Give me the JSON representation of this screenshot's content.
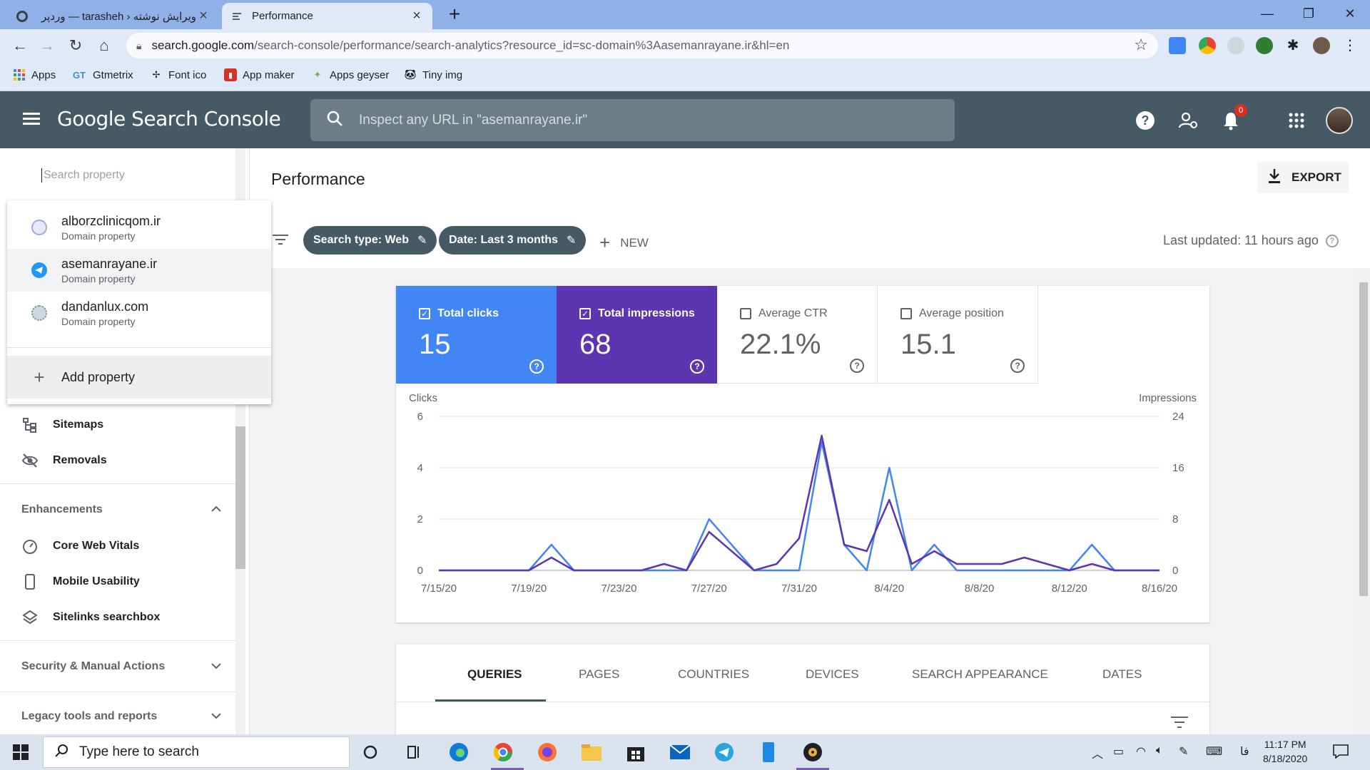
{
  "browser": {
    "tabs": [
      {
        "title": "ویرایش نوشته ‹ tarasheh — وردپر",
        "active": false
      },
      {
        "title": "Performance",
        "active": true
      }
    ],
    "url_host": "search.google.com",
    "url_path": "/search-console/performance/search-analytics?resource_id=sc-domain%3Aasemanrayane.ir&hl=en",
    "bookmarks": [
      "Apps",
      "Gtmetrix",
      "Font ico",
      "App maker",
      "Apps geyser",
      "Tiny img"
    ]
  },
  "header": {
    "logo_text": "Google Search Console",
    "search_placeholder": "Inspect any URL in \"asemanrayane.ir\"",
    "notification_count": "0"
  },
  "sidebar": {
    "search_placeholder": "Search property",
    "items_top": [
      {
        "label": "Sitemaps",
        "icon": "sitemap-icon"
      },
      {
        "label": "Removals",
        "icon": "removals-icon"
      }
    ],
    "enhancements_label": "Enhancements",
    "enhancement_items": [
      {
        "label": "Core Web Vitals",
        "icon": "speedometer-icon"
      },
      {
        "label": "Mobile Usability",
        "icon": "phone-icon"
      },
      {
        "label": "Sitelinks searchbox",
        "icon": "layers-icon"
      }
    ],
    "security_label": "Security & Manual Actions",
    "legacy_label": "Legacy tools and reports"
  },
  "property_dropdown": {
    "properties": [
      {
        "name": "alborzclinicqom.ir",
        "type": "Domain property",
        "selected": false
      },
      {
        "name": "asemanrayane.ir",
        "type": "Domain property",
        "selected": true
      },
      {
        "name": "dandanlux.com",
        "type": "Domain property",
        "selected": false
      }
    ],
    "add_label": "Add property"
  },
  "performance": {
    "title": "Performance",
    "export_label": "EXPORT",
    "filters": [
      {
        "label": "Search type: Web"
      },
      {
        "label": "Date: Last 3 months"
      }
    ],
    "new_label": "NEW",
    "last_updated": "Last updated: 11 hours ago",
    "metrics": {
      "clicks": {
        "label": "Total clicks",
        "value": "15",
        "checked": true,
        "color": "#4285f4"
      },
      "impressions": {
        "label": "Total impressions",
        "value": "68",
        "checked": true,
        "color": "#5e35b1"
      },
      "ctr": {
        "label": "Average CTR",
        "value": "22.1%",
        "checked": false
      },
      "position": {
        "label": "Average position",
        "value": "15.1",
        "checked": false
      }
    },
    "tabs": [
      "QUERIES",
      "PAGES",
      "COUNTRIES",
      "DEVICES",
      "SEARCH APPEARANCE",
      "DATES"
    ]
  },
  "chart_data": {
    "type": "line",
    "ylabel_left": "Clicks",
    "ylabel_right": "Impressions",
    "ylim_left": [
      0,
      6
    ],
    "ylim_right": [
      0,
      24
    ],
    "yticks_left": [
      "0",
      "2",
      "4",
      "6"
    ],
    "yticks_right": [
      "0",
      "8",
      "16",
      "24"
    ],
    "xtick_labels": [
      "7/15/20",
      "7/19/20",
      "7/23/20",
      "7/27/20",
      "7/31/20",
      "8/4/20",
      "8/8/20",
      "8/12/20",
      "8/16/20"
    ],
    "x": [
      "7/15/20",
      "7/16/20",
      "7/17/20",
      "7/18/20",
      "7/19/20",
      "7/20/20",
      "7/21/20",
      "7/22/20",
      "7/23/20",
      "7/24/20",
      "7/25/20",
      "7/26/20",
      "7/27/20",
      "7/28/20",
      "7/29/20",
      "7/30/20",
      "7/31/20",
      "8/1/20",
      "8/2/20",
      "8/3/20",
      "8/4/20",
      "8/5/20",
      "8/6/20",
      "8/7/20",
      "8/8/20",
      "8/9/20",
      "8/10/20",
      "8/11/20",
      "8/12/20",
      "8/13/20",
      "8/14/20",
      "8/15/20",
      "8/16/20"
    ],
    "series": [
      {
        "name": "Clicks",
        "axis": "left",
        "color": "#4285f4",
        "values": [
          0,
          0,
          0,
          0,
          0,
          1,
          0,
          0,
          0,
          0,
          0,
          0,
          2,
          1,
          0,
          0,
          0,
          5,
          1,
          0,
          4,
          0,
          1,
          0,
          0,
          0,
          0,
          0,
          0,
          1,
          0,
          0,
          0
        ]
      },
      {
        "name": "Impressions",
        "axis": "right",
        "color": "#5e35b1",
        "values": [
          0,
          0,
          0,
          0,
          0,
          2,
          0,
          0,
          0,
          0,
          1,
          0,
          6,
          3,
          0,
          1,
          5,
          21,
          4,
          3,
          11,
          1,
          3,
          1,
          1,
          1,
          2,
          1,
          0,
          1,
          0,
          0,
          0
        ]
      }
    ],
    "grid": true
  },
  "taskbar": {
    "search_label": "Type here to search",
    "time": "11:17 PM",
    "date": "8/18/2020",
    "lang": "فا"
  }
}
